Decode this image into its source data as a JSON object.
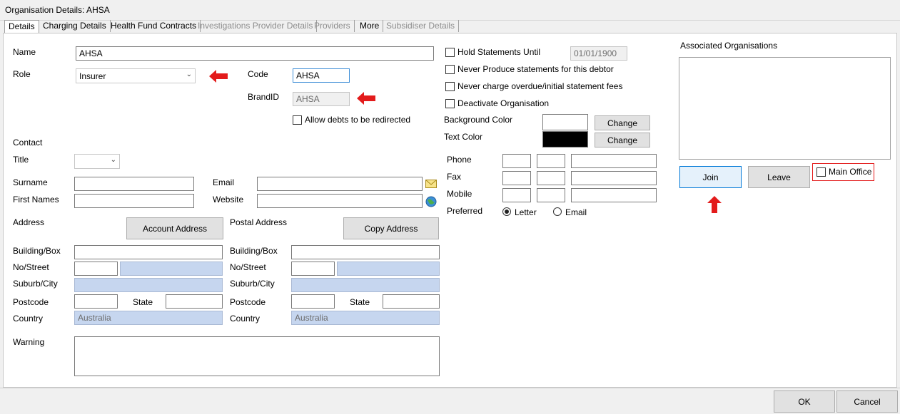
{
  "window": {
    "title": "Organisation Details: AHSA"
  },
  "tabs": [
    "Details",
    "Charging Details",
    "Health Fund Contracts",
    "Investigations Provider Details",
    "Providers",
    "More",
    "Subsidiser Details"
  ],
  "details": {
    "name_label": "Name",
    "name_value": "AHSA",
    "role_label": "Role",
    "role_value": "Insurer",
    "code_label": "Code",
    "code_value": "AHSA",
    "brandid_label": "BrandID",
    "brandid_value": "AHSA",
    "allow_redirect_label": "Allow debts to be redirected",
    "contact_label": "Contact",
    "title_label": "Title",
    "surname_label": "Surname",
    "firstnames_label": "First Names",
    "email_label": "Email",
    "website_label": "Website",
    "address_label": "Address",
    "account_address_btn": "Account Address",
    "postal_address_label": "Postal Address",
    "copy_address_btn": "Copy Address",
    "building_label": "Building/Box",
    "street_label": "No/Street",
    "suburb_label": "Suburb/City",
    "postcode_label": "Postcode",
    "state_label": "State",
    "country_label": "Country",
    "country_value": "Australia",
    "postal_country_value": "Australia",
    "warning_label": "Warning"
  },
  "statements": {
    "hold_label": "Hold Statements Until",
    "hold_date": "01/01/1900",
    "never_produce_label": "Never Produce statements for this debtor",
    "never_charge_label": "Never charge overdue/initial statement fees",
    "deactivate_label": "Deactivate Organisation",
    "bg_color_label": "Background Color",
    "text_color_label": "Text Color",
    "change_btn": "Change"
  },
  "contact_numbers": {
    "phone_label": "Phone",
    "fax_label": "Fax",
    "mobile_label": "Mobile",
    "preferred_label": "Preferred",
    "letter_label": "Letter",
    "email_label": "Email"
  },
  "associated": {
    "title": "Associated Organisations",
    "join_btn": "Join",
    "leave_btn": "Leave",
    "main_office_label": "Main Office"
  },
  "footer": {
    "ok": "OK",
    "cancel": "Cancel"
  },
  "colors": {
    "annotation_red": "#e31b1b",
    "focus_blue": "#0078d7",
    "readonly_blue": "#c6d6ef"
  },
  "icons": {
    "email": "envelope-icon",
    "website": "globe-icon"
  }
}
